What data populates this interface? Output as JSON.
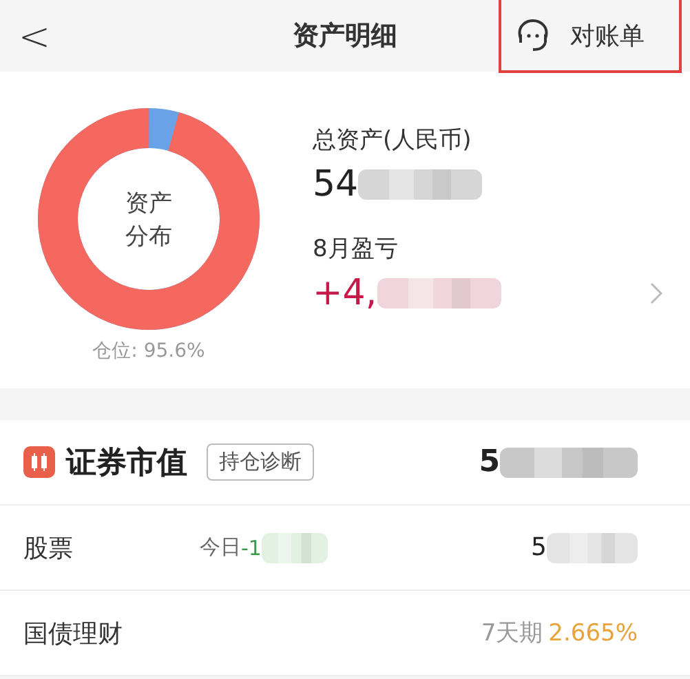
{
  "header": {
    "back": "<",
    "title": "资产明细",
    "action": "对账单",
    "action_highlighted": true
  },
  "summary": {
    "donut_label": [
      "资产",
      "分布"
    ],
    "position": {
      "label": "仓位: ",
      "value": "95.6%"
    },
    "total": {
      "label": "总资产(人民币)",
      "value": "54"
    },
    "profit": {
      "label": "8月盈亏",
      "value": "+4,"
    }
  },
  "section": {
    "title": "证券市值",
    "button": "持仓诊断",
    "value": "5"
  },
  "rows": [
    {
      "kind": "today",
      "name": "股票",
      "today_label": "今日",
      "today_value": "-1",
      "value": "5"
    },
    {
      "kind": "rate",
      "name": "国债理财",
      "term": "7天期",
      "rate": "2.665%"
    }
  ]
}
